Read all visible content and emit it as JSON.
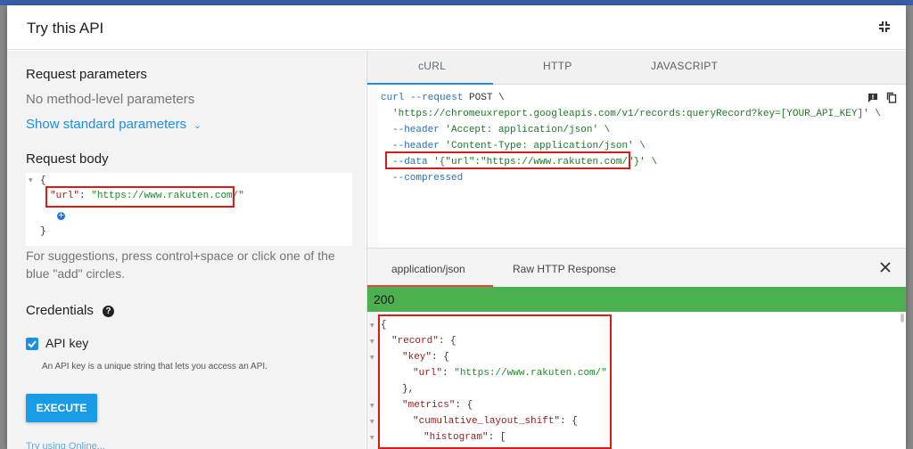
{
  "dialog": {
    "title": "Try this API",
    "collapse_icon": "collapse-icon"
  },
  "left": {
    "request_parameters_title": "Request parameters",
    "no_params": "No method-level parameters",
    "show_standard": "Show standard parameters",
    "request_body_title": "Request body",
    "body_open": "{",
    "body_key": "\"url\"",
    "body_colon": ": ",
    "body_value": "\"https://www.rakuten.com/\"",
    "body_close": "}",
    "suggestions_line1": "For suggestions, press control+space or click one of the",
    "suggestions_line2": "blue \"add\" circles.",
    "credentials_title": "Credentials",
    "api_key_label": "API key",
    "api_key_desc": "An API key is a unique string that lets you access an API.",
    "execute_label": "EXECUTE",
    "partial_link": "Try using Online..."
  },
  "right": {
    "tabs": [
      "cURL",
      "HTTP",
      "JAVASCRIPT"
    ],
    "active_tab": "cURL",
    "curl": {
      "l1_cmd": "curl --request",
      "l1_rest": " POST \\",
      "l2": "'https://chromeuxreport.googleapis.com/v1/records:queryRecord?key=[YOUR_API_KEY]' \\",
      "l3_flag": "--header",
      "l3_rest": " 'Accept: application/json' \\",
      "l4_flag": "--header",
      "l4_rest": " 'Content-Type: application/json' \\",
      "l5_flag": "--data",
      "l5_rest": " '{\"url\":\"https://www.rakuten.com/\"}' \\",
      "l6_flag": "--compressed"
    },
    "response_tabs": [
      "application/json",
      "Raw HTTP Response"
    ],
    "status": "200",
    "response": {
      "l1": "{",
      "l2_key": "\"record\"",
      "l2_rest": ": {",
      "l3_key": "\"key\"",
      "l3_rest": ": {",
      "l4_key": "\"url\"",
      "l4_rest": ": ",
      "l4_val": "\"https://www.rakuten.com/\"",
      "l5": "},",
      "l6_key": "\"metrics\"",
      "l6_rest": ": {",
      "l7_key": "\"cumulative_layout_shift\"",
      "l7_rest": ": {",
      "l8_key": "\"histogram\"",
      "l8_rest": ": ["
    }
  }
}
